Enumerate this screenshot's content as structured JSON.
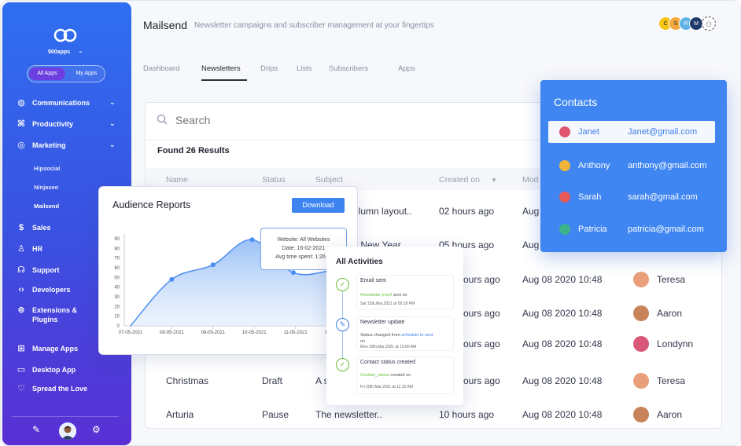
{
  "sidebar": {
    "brand": "500apps",
    "toggle": {
      "all": "All Apps",
      "my": "My Apps"
    },
    "groups": [
      {
        "label": "Communications",
        "icon": "globe-icon"
      },
      {
        "label": "Productivity",
        "icon": "command-icon"
      },
      {
        "label": "Marketing",
        "icon": "target-icon"
      }
    ],
    "marketing_items": [
      "Hipsocial",
      "Ninjaseo",
      "Mailsend"
    ],
    "items": [
      {
        "label": "Sales",
        "icon": "dollar-icon"
      },
      {
        "label": "HR",
        "icon": "user-icon"
      },
      {
        "label": "Support",
        "icon": "headset-icon"
      },
      {
        "label": "Developers",
        "icon": "code-icon"
      },
      {
        "label": "Extensions &",
        "label2": "Plugins",
        "icon": "extensions-icon"
      }
    ],
    "bottom_items": [
      {
        "label": "Manage Apps",
        "icon": "grid-icon"
      },
      {
        "label": "Desktop App",
        "icon": "monitor-icon"
      },
      {
        "label": "Spread the Love",
        "icon": "heart-icon"
      }
    ]
  },
  "header": {
    "title": "Mailsend",
    "tagline": "Newsletter campaigns and subscriber management at your fingertips",
    "team": [
      "C",
      "S",
      "R",
      "M"
    ]
  },
  "tabs": [
    "Dashboard",
    "Newsletters",
    "Drips",
    "Lists",
    "Subscribers",
    "Apps"
  ],
  "active_tab": "Newsletters",
  "search": {
    "placeholder": "Search"
  },
  "results": {
    "label": "Found 26 Results"
  },
  "table": {
    "columns": [
      "Name",
      "Status",
      "Subject",
      "Created on",
      "Mod"
    ],
    "rows": [
      {
        "name": "",
        "status": "",
        "subject": "olumn layout..",
        "created": "02 hours ago",
        "modified": "Aug",
        "owner": ""
      },
      {
        "name": "",
        "status": "",
        "subject": "y New Year..",
        "created": "05 hours ago",
        "modified": "Aug",
        "owner": ""
      },
      {
        "name": "",
        "status": "",
        "subject": "",
        "created": "ours ago",
        "modified": "Aug 08 2020 10:48",
        "owner": "Teresa"
      },
      {
        "name": "",
        "status": "",
        "subject": "",
        "created": "ours ago",
        "modified": "Aug 08 2020 10:48",
        "owner": "Aaron"
      },
      {
        "name": "",
        "status": "",
        "subject": "",
        "created": "ours ago",
        "modified": "Aug 08 2020 10:48",
        "owner": "Londynn"
      },
      {
        "name": "Christmas",
        "status": "Draft",
        "subject": "A s",
        "created": "ours ago",
        "modified": "Aug 08 2020 10:48",
        "owner": "Teresa"
      },
      {
        "name": "Arturia",
        "status": "Pause",
        "subject": "The newsletter..",
        "created": "10 hours ago",
        "modified": "Aug 08 2020 10:48",
        "owner": "Aaron"
      }
    ]
  },
  "audience_report": {
    "title": "Audience Reports",
    "download_label": "Download",
    "tooltip": {
      "line1": "Website: All Websites",
      "line2": "Date: 16-02-2021",
      "line3": "Avg time spent: 1:26 m"
    }
  },
  "chart_data": {
    "type": "area",
    "x": [
      "07-05-2021",
      "08-05-2021",
      "09-05-2021",
      "10-05-2021",
      "11-05-2021",
      "12-05-2021"
    ],
    "yticks": [
      0,
      10,
      20,
      30,
      40,
      50,
      60,
      70,
      80,
      90
    ],
    "ylim": [
      0,
      90
    ],
    "points": [
      {
        "x": 0.0,
        "y": 0
      },
      {
        "x": 1.0,
        "y": 48
      },
      {
        "x": 2.0,
        "y": 63
      },
      {
        "x": 2.95,
        "y": 89
      },
      {
        "x": 3.95,
        "y": 55
      },
      {
        "x": 4.85,
        "y": 57
      },
      {
        "x": 5.5,
        "y": 62
      }
    ],
    "color": "#4a8df0"
  },
  "activities": {
    "title": "All Activities",
    "items": [
      {
        "title": "Email sent",
        "detail_link": "Newsletter proof",
        "detail_rest": " sent on",
        "time": "Sat 15th,Mar,2021 at 09:18 PM",
        "icon": "check-icon"
      },
      {
        "title": "Newsletter update",
        "detail_rest": "Status changed from ",
        "detail_link": "schedule to sent",
        "detail_on": "on",
        "time": "Mon 18th,Mar,2021 at 10:00 AM",
        "icon": "pencil-icon"
      },
      {
        "title": "Contact status created",
        "detail_link": "Contact_status",
        "detail_rest": " created on",
        "time": "Fri 20th,Mar,2021 at 11:15 AM",
        "icon": "check-icon"
      }
    ]
  },
  "contacts": {
    "title": "Contacts",
    "items": [
      {
        "name": "Janet",
        "email": "Janet@gmail.com",
        "color": "#e0566e"
      },
      {
        "name": "Anthony",
        "email": "anthony@gmail.com",
        "color": "#f0b43a"
      },
      {
        "name": "Sarah",
        "email": "sarah@gmail.com",
        "color": "#e85a5a"
      },
      {
        "name": "Patricia",
        "email": "patricia@gmail.com",
        "color": "#3cb38a"
      }
    ]
  },
  "colors": {
    "accent": "#3d84f0",
    "sidebar_top": "#2f6ff0",
    "sidebar_bottom": "#5a2fd3",
    "contacts_bg": "#3f86f2"
  }
}
